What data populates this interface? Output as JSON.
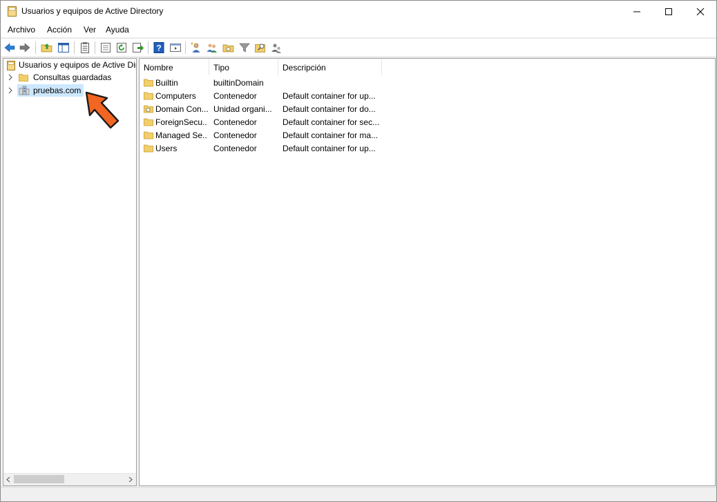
{
  "window": {
    "title": "Usuarios y equipos de Active Directory",
    "controls": {
      "minimize": "minimize-icon",
      "maximize": "maximize-icon",
      "close": "close-icon"
    }
  },
  "menu": {
    "items": [
      {
        "label": "Archivo"
      },
      {
        "label": "Acción"
      },
      {
        "label": "Ver"
      },
      {
        "label": "Ayuda"
      }
    ]
  },
  "toolbar": {
    "icons": [
      "back-arrow-icon",
      "forward-arrow-icon",
      "up-folder-icon",
      "show-hide-tree-icon",
      "clipboard-icon",
      "properties-icon",
      "refresh-icon",
      "export-list-icon",
      "help-icon",
      "console-icon",
      "new-user-icon",
      "new-group-icon",
      "new-ou-icon",
      "filter-icon",
      "find-icon",
      "delegate-icon"
    ]
  },
  "tree": {
    "root": {
      "label": "Usuarios y equipos de Active Directory"
    },
    "items": [
      {
        "label": "Consultas guardadas",
        "icon": "folder-icon"
      },
      {
        "label": "pruebas.com",
        "icon": "domain-icon",
        "selected": true
      }
    ]
  },
  "list": {
    "columns": [
      {
        "label": "Nombre"
      },
      {
        "label": "Tipo"
      },
      {
        "label": "Descripción"
      }
    ],
    "rows": [
      {
        "name": "Builtin",
        "type": "builtinDomain",
        "description": "",
        "icon": "folder-icon"
      },
      {
        "name": "Computers",
        "type": "Contenedor",
        "description": "Default container for up...",
        "icon": "folder-icon"
      },
      {
        "name": "Domain Con...",
        "type": "Unidad organi...",
        "description": "Default container for do...",
        "icon": "ou-folder-icon"
      },
      {
        "name": "ForeignSecu...",
        "type": "Contenedor",
        "description": "Default container for sec...",
        "icon": "folder-icon"
      },
      {
        "name": "Managed Se...",
        "type": "Contenedor",
        "description": "Default container for ma...",
        "icon": "folder-icon"
      },
      {
        "name": "Users",
        "type": "Contenedor",
        "description": "Default container for up...",
        "icon": "folder-icon"
      }
    ]
  },
  "colors": {
    "accent": "#f26522",
    "selection": "#cce8ff",
    "folder": "#f2cf6b"
  }
}
